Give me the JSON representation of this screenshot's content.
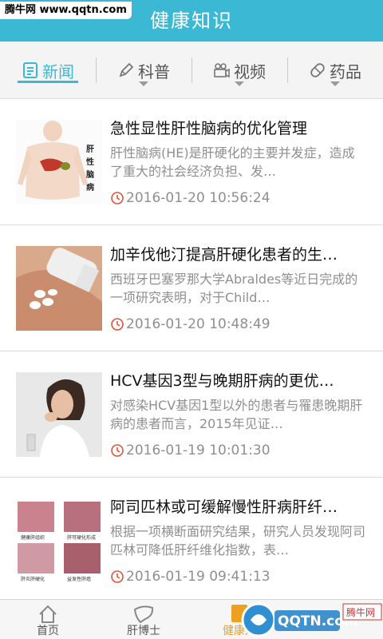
{
  "watermark_top": "腾牛网 www.qqtn.com",
  "header": {
    "title": "健康知识"
  },
  "tabs": [
    {
      "label": "新闻",
      "icon": "news-icon",
      "active": true
    },
    {
      "label": "科普",
      "icon": "pencil-icon",
      "active": false
    },
    {
      "label": "视频",
      "icon": "video-camera-icon",
      "active": false
    },
    {
      "label": "药品",
      "icon": "pill-icon",
      "active": false
    }
  ],
  "articles": [
    {
      "title": "急性显性肝性脑病的优化管理",
      "summary": "肝性脑病(HE)是肝硬化的主要并发症，造成了重大的社会经济负担、发…",
      "time": "2016-01-20 10:56:24",
      "thumb_label": "肝性脑病"
    },
    {
      "title": "加辛伐他汀提高肝硬化患者的生…",
      "summary": "西班牙巴塞罗那大学Abraldes等近日完成的一项研究表明，对于Child…",
      "time": "2016-01-20 10:48:49"
    },
    {
      "title": "HCV基因3型与晚期肝病的更优…",
      "summary": "对感染HCV基因1型以外的患者与罹患晚期肝病的患者而言，2015年见证…",
      "time": "2016-01-19 10:01:30"
    },
    {
      "title": "阿司匹林或可缓解慢性肝病肝纤…",
      "summary": "根据一项横断面研究结果，研究人员发现阿司匹林可降低肝纤维化指数，表…",
      "time": "2016-01-19 09:41:13",
      "thumb_captions": [
        "健康肝组织",
        "肝可硬化形成",
        "肝炎肝硬化",
        "益发性肝癌"
      ]
    }
  ],
  "bottom_nav": [
    {
      "label": "首页",
      "icon": "home-icon"
    },
    {
      "label": "肝博士",
      "icon": "liver-icon"
    },
    {
      "label": "健康知",
      "icon": "knowledge-icon",
      "active": true
    }
  ],
  "watermark_bottom": {
    "text": "QQTN.com",
    "badge": "腾牛网"
  },
  "colors": {
    "accent": "#3bb8d3",
    "active_nav": "#f0a020"
  }
}
